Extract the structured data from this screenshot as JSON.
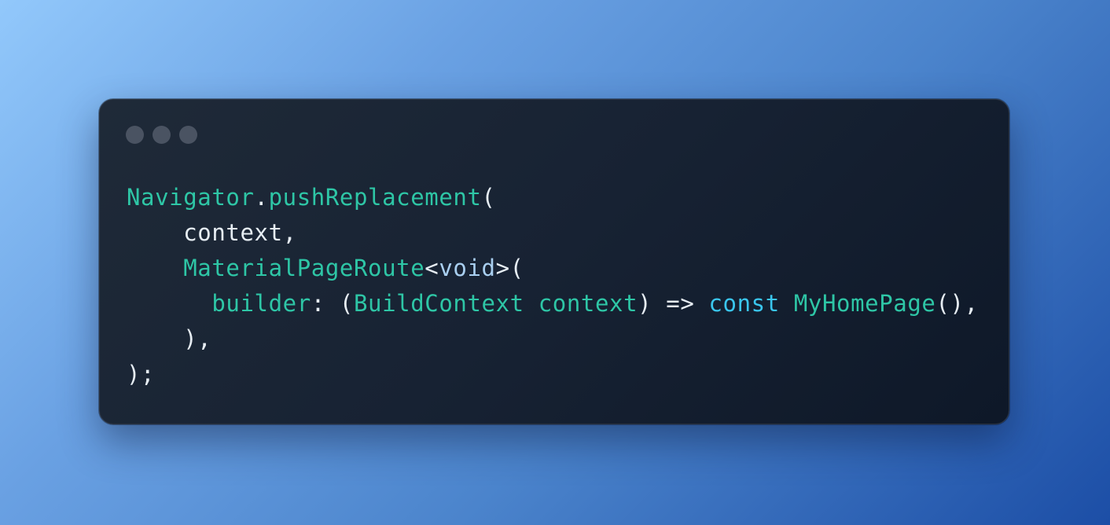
{
  "window": {
    "controls": [
      "dot",
      "dot",
      "dot"
    ]
  },
  "code": {
    "lines": [
      [
        {
          "t": "Navigator",
          "c": "type"
        },
        {
          "t": ".",
          "c": "punct"
        },
        {
          "t": "pushReplacement",
          "c": "fn"
        },
        {
          "t": "(",
          "c": "punct"
        }
      ],
      [
        {
          "t": "    ",
          "c": "plain"
        },
        {
          "t": "context",
          "c": "plain"
        },
        {
          "t": ",",
          "c": "punct"
        }
      ],
      [
        {
          "t": "    ",
          "c": "plain"
        },
        {
          "t": "MaterialPageRoute",
          "c": "type"
        },
        {
          "t": "<",
          "c": "punct"
        },
        {
          "t": "void",
          "c": "kwv"
        },
        {
          "t": ">(",
          "c": "punct"
        }
      ],
      [
        {
          "t": "      ",
          "c": "plain"
        },
        {
          "t": "builder",
          "c": "type"
        },
        {
          "t": ": (",
          "c": "punct"
        },
        {
          "t": "BuildContext",
          "c": "type"
        },
        {
          "t": " ",
          "c": "plain"
        },
        {
          "t": "context",
          "c": "type"
        },
        {
          "t": ") => ",
          "c": "punct"
        },
        {
          "t": "const",
          "c": "kw"
        },
        {
          "t": " ",
          "c": "plain"
        },
        {
          "t": "MyHomePage",
          "c": "type"
        },
        {
          "t": "(),",
          "c": "punct"
        }
      ],
      [
        {
          "t": "    ",
          "c": "plain"
        },
        {
          "t": "),",
          "c": "punct"
        }
      ],
      [
        {
          "t": ");",
          "c": "punct"
        }
      ]
    ]
  },
  "colors": {
    "type": "#2ec6a6",
    "keyword": "#3ac6ee",
    "void": "#a9cff0",
    "text": "#e6edf3",
    "window_control": "#4a5362"
  }
}
